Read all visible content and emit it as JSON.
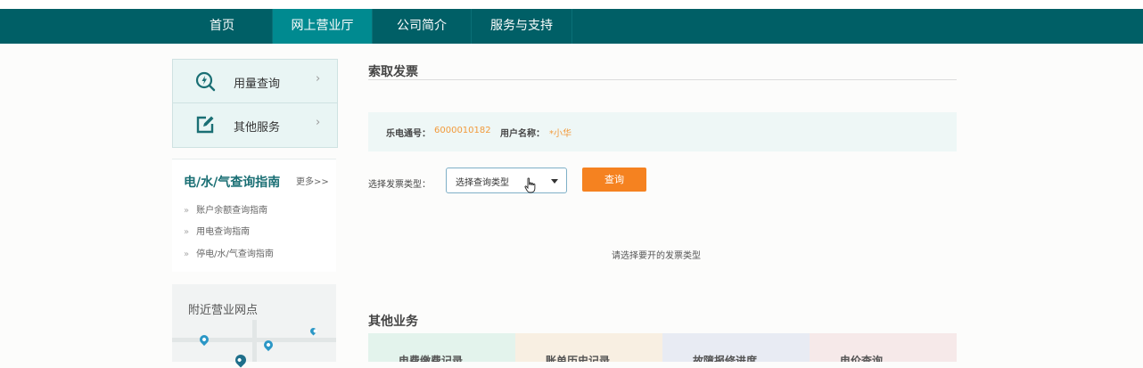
{
  "nav": {
    "items": [
      {
        "label": "首页",
        "active": false
      },
      {
        "label": "网上营业厅",
        "active": true
      },
      {
        "label": "公司简介",
        "active": false
      },
      {
        "label": "服务与支持",
        "active": false
      }
    ]
  },
  "sidebar": {
    "menu": [
      {
        "label": "用量查询",
        "icon": "usage-gauge-icon",
        "chevron": "›"
      },
      {
        "label": "其他服务",
        "icon": "edit-icon",
        "chevron": "›"
      }
    ],
    "guide": {
      "title": "电/水/气查询指南",
      "more": "更多>>",
      "links": [
        {
          "bullet": "»",
          "label": "账户余额查询指南"
        },
        {
          "bullet": "»",
          "label": "用电查询指南"
        },
        {
          "bullet": "»",
          "label": "停电/水/气查询指南"
        }
      ]
    },
    "nearby": {
      "title": "附近营业网点"
    }
  },
  "main": {
    "title": "索取发票",
    "info": {
      "account_label": "乐电通号：",
      "account_value": "6000010182",
      "user_label": "用户名称：",
      "user_value": "*小华"
    },
    "invoice_type": {
      "label": "选择发票类型：",
      "selected": "选择查询类型"
    },
    "query_button": "查询",
    "hint": "请选择要开的发票类型",
    "other_title": "其他业务",
    "other_tiles": [
      {
        "label": "电费缴费记录",
        "color": "#e3f3ec"
      },
      {
        "label": "账单历史记录",
        "color": "#f8efe2"
      },
      {
        "label": "故障报修进度",
        "color": "#e8ebf3"
      },
      {
        "label": "电价查询",
        "color": "#f6e9e9"
      }
    ]
  },
  "colors": {
    "nav_bg": "#005f66",
    "nav_active": "#008a90",
    "accent_orange": "#f58220",
    "info_value": "#f29a3b",
    "guide_title": "#1a6f74"
  }
}
